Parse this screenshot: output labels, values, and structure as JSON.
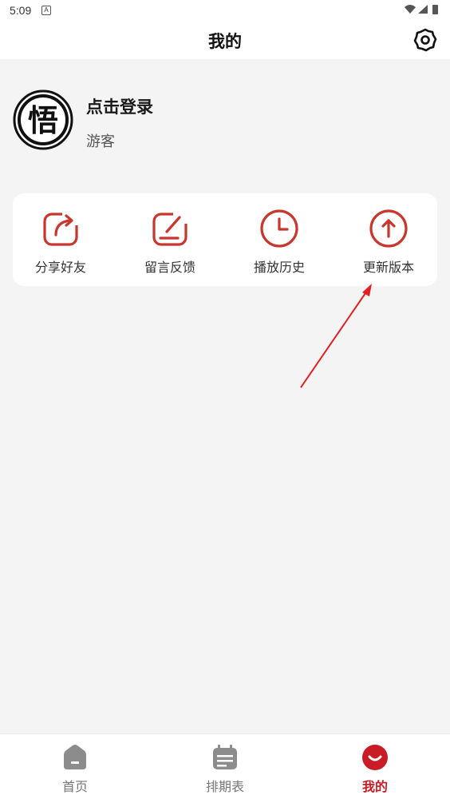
{
  "status_bar": {
    "time": "5:09",
    "notification_glyph": "A"
  },
  "header": {
    "title": "我的"
  },
  "profile": {
    "avatar_char": "悟",
    "login_text": "点击登录",
    "guest_label": "游客"
  },
  "quick_actions": [
    {
      "label": "分享好友",
      "icon": "share-icon"
    },
    {
      "label": "留言反馈",
      "icon": "feedback-icon"
    },
    {
      "label": "播放历史",
      "icon": "clock-icon"
    },
    {
      "label": "更新版本",
      "icon": "arrow-up-circle-icon"
    }
  ],
  "bottom_nav": [
    {
      "label": "首页",
      "icon": "home-icon",
      "active": false
    },
    {
      "label": "排期表",
      "icon": "calendar-icon",
      "active": false
    },
    {
      "label": "我的",
      "icon": "smile-icon",
      "active": true
    }
  ],
  "colors": {
    "accent": "#c81d25",
    "icon_red": "#c8372d",
    "inactive": "#777777",
    "background": "#f4f4f4"
  }
}
